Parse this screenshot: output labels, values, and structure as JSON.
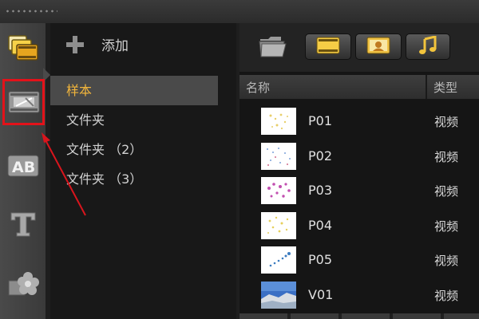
{
  "left_rail": {
    "items": [
      {
        "icon": "media-library-icon"
      },
      {
        "icon": "video-transition-icon"
      },
      {
        "icon": "ab-title-icon"
      },
      {
        "icon": "text-t-icon"
      },
      {
        "icon": "flower-effects-icon"
      }
    ],
    "active_index": 1,
    "highlight_color": "#e3121a"
  },
  "library": {
    "add_label": "添加",
    "folders": [
      "样本",
      "文件夹",
      "文件夹 （2）",
      "文件夹 （3）"
    ],
    "selected_index": 0,
    "selected_color": "#f0b43c"
  },
  "media": {
    "toolbar": {
      "icons": [
        "open-folder-icon",
        "video-filter-icon",
        "photo-filter-icon",
        "audio-filter-icon"
      ]
    },
    "columns": {
      "name": "名称",
      "type": "类型"
    },
    "items": [
      {
        "name": "P01",
        "type": "视频"
      },
      {
        "name": "P02",
        "type": "视频"
      },
      {
        "name": "P03",
        "type": "视频"
      },
      {
        "name": "P04",
        "type": "视频"
      },
      {
        "name": "P05",
        "type": "视频"
      },
      {
        "name": "V01",
        "type": "视频"
      }
    ]
  }
}
